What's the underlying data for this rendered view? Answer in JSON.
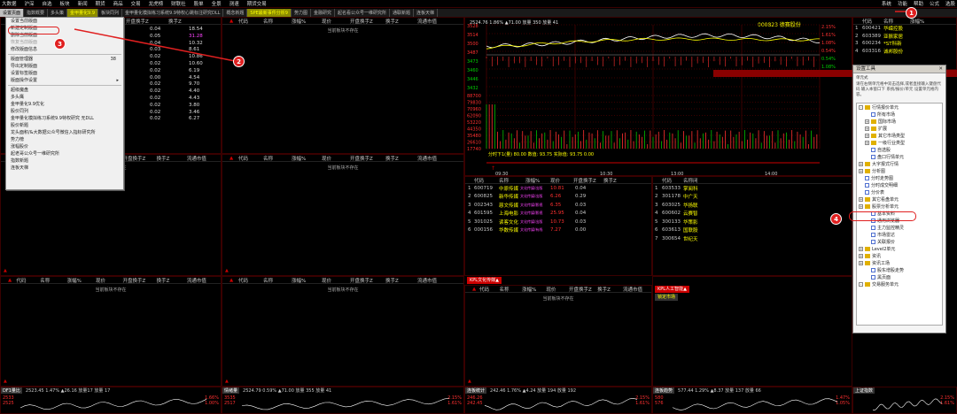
{
  "menubar": {
    "items": [
      "大数据",
      "沪深",
      "自选",
      "板块",
      "新闻",
      "期货",
      "商品",
      "交易",
      "龙虎榜",
      "财联社",
      "股单",
      "全景",
      "测速",
      "期货交易"
    ],
    "right": [
      "系统",
      "功能",
      "帮助",
      "公式",
      "选股"
    ]
  },
  "tabs": [
    "设置页面",
    "指数概要",
    "多头策",
    "金甲量化9.9",
    "板块同列",
    "金甲量化模拟练习系统9.9特权心跳标注研究DLL",
    "概念新题",
    "SPE最新事件分析9",
    "势力图",
    "金融研究",
    "起名看公众号一维研究所",
    "通联新题",
    "连板天梯"
  ],
  "context_menu": {
    "items": [
      {
        "label": "设置当前版面",
        "state": "normal"
      },
      {
        "label": "新建定制版面",
        "state": "normal"
      },
      {
        "label": "删除当前版面",
        "state": "normal"
      },
      {
        "label": "恢复当前版面",
        "state": "dim"
      },
      {
        "label": "修改版面信息",
        "state": "normal"
      },
      {
        "label": "sep",
        "state": "sep"
      },
      {
        "label": "版面管理器",
        "state": "normal",
        "shortcut": "38"
      },
      {
        "label": "导出定制版面",
        "state": "normal"
      },
      {
        "label": "设置标签版面",
        "state": "normal"
      },
      {
        "label": "版面操作设置",
        "state": "normal",
        "arrow": true
      },
      {
        "label": "sep",
        "state": "sep"
      },
      {
        "label": "超级魔盘",
        "state": "normal"
      },
      {
        "label": "多头鹰",
        "state": "normal"
      },
      {
        "label": "金甲量化9.9优化",
        "state": "normal"
      },
      {
        "label": "股价同列",
        "state": "normal"
      },
      {
        "label": "金甲量化模拟练习系统9.9特权研究 无DLL",
        "state": "normal"
      },
      {
        "label": "股价新题",
        "state": "normal"
      },
      {
        "label": "龙头面积/&大数据公众号微信入指标研究所",
        "state": "normal"
      },
      {
        "label": "势力榜",
        "state": "normal"
      },
      {
        "label": "涨幅股价",
        "state": "normal"
      },
      {
        "label": "起老哥公众号一维研究所",
        "state": "normal"
      },
      {
        "label": "指数新题",
        "state": "normal"
      },
      {
        "label": "连板天梯",
        "state": "normal"
      }
    ]
  },
  "left_numbers": {
    "col_a": [
      "0.04",
      "0.05",
      "0.04",
      "0.03",
      "0.02",
      "0.02",
      "0.02",
      "0.00",
      "0.02",
      "0.02",
      "0.02",
      "0.02",
      "0.02",
      "0.02"
    ],
    "col_b": [
      "18.54",
      "31.28",
      "10.32",
      "8.61",
      "10.86",
      "10.60",
      "6.19",
      "4.54",
      "9.70",
      "4.40",
      "4.43",
      "3.80",
      "3.46",
      "6.27"
    ],
    "head": [
      "开盘换手Z",
      "换手Z"
    ]
  },
  "panel_headers": {
    "common": [
      "代码",
      "名称",
      "涨幅%",
      "现价",
      "开盘换手Z",
      "换手Z",
      "流通市值"
    ],
    "empty_text": "当前板块不存在"
  },
  "intraday": {
    "code_title": "000823 德赛股份",
    "top_label": "2524.76  1.86%  ▲71.00  放量 350  放量 41",
    "price_left": [
      "3528",
      "3514",
      "3500",
      "3487",
      "3473",
      "3460",
      "3446",
      "3432"
    ],
    "pct_right": [
      "2.15%",
      "1.61%",
      "1.08%",
      "0.54%",
      "0.54%",
      "1.08%",
      "1.61%"
    ],
    "volume_left": [
      "88700",
      "79830",
      "70960",
      "62090",
      "53220",
      "44350",
      "35480",
      "26610",
      "17740"
    ],
    "indicator_line": "分时下1(量) 80.00  数值: 93.75  实际值: 93.75  0.00",
    "times": [
      "09:30",
      "10:30",
      "13:00",
      "14:00"
    ]
  },
  "stock_table": {
    "header": [
      "代码",
      "名称",
      "涨幅%",
      "现价",
      "开盘换手Z",
      "换手Z"
    ],
    "rows": [
      {
        "idx": "1",
        "code": "600719",
        "name": "中原传媒",
        "pct": "",
        "price": "10.81",
        "t1": "0.04",
        "tag": "文化传媒/出版"
      },
      {
        "idx": "2",
        "code": "600825",
        "name": "新华传媒",
        "pct": "",
        "price": "6.26",
        "t1": "0.29",
        "tag": "文化传媒/出版"
      },
      {
        "idx": "3",
        "code": "002343",
        "name": "慈文传媒",
        "pct": "",
        "price": "6.35",
        "t1": "0.03",
        "tag": "文化传媒/影视"
      },
      {
        "idx": "4",
        "code": "601595",
        "name": "上海电影",
        "pct": "",
        "price": "25.95",
        "t1": "0.04",
        "tag": "文化传媒/影视"
      },
      {
        "idx": "5",
        "code": "301025",
        "name": "读客文化",
        "pct": "",
        "price": "10.73",
        "t1": "0.03",
        "tag": "文化传媒/出版"
      },
      {
        "idx": "6",
        "code": "000156",
        "name": "华数传媒",
        "pct": "",
        "price": "7.27",
        "t1": "0.00",
        "tag": "文化传媒/有线"
      }
    ]
  },
  "right_top": {
    "header": [
      "代码",
      "名称",
      "涨幅%"
    ],
    "rows": [
      {
        "idx": "1",
        "code": "600421",
        "name": "华嵘控股"
      },
      {
        "idx": "2",
        "code": "603389",
        "name": "亚振家居"
      },
      {
        "idx": "3",
        "code": "600234",
        "name": "*ST科新"
      },
      {
        "idx": "4",
        "code": "603316",
        "name": "诚邦股份"
      }
    ]
  },
  "right_mid": {
    "header": [
      "代码",
      "名称闭"
    ],
    "rows": [
      {
        "idx": "1",
        "code": "603533",
        "name": "掌阅科"
      },
      {
        "idx": "2",
        "code": "301178",
        "name": "中广天"
      },
      {
        "idx": "3",
        "code": "603025",
        "name": "华扬联"
      },
      {
        "idx": "4",
        "code": "600602",
        "name": "云赛智"
      },
      {
        "idx": "5",
        "code": "300133",
        "name": "华策影"
      },
      {
        "idx": "6",
        "code": "603613",
        "name": "国联股"
      },
      {
        "idx": "7",
        "code": "300654",
        "name": "世纪天"
      }
    ]
  },
  "dialog": {
    "title": "设置工具",
    "subtitle": "单元式",
    "desc": "请在右侧单元格中双击选择,或者直接输入键盘代码 输入本窗口下 系统/报价/单元 设置单元格内容。",
    "tree": [
      {
        "label": "行情报价单元",
        "type": "folder",
        "depth": 0,
        "exp": "-"
      },
      {
        "label": "所有市场",
        "type": "page",
        "depth": 1
      },
      {
        "label": "国际市场",
        "type": "folder",
        "depth": 1,
        "exp": "+"
      },
      {
        "label": "扩展",
        "type": "folder",
        "depth": 1,
        "exp": "+"
      },
      {
        "label": "其它市场类型",
        "type": "folder",
        "depth": 1,
        "exp": "+"
      },
      {
        "label": "一级行业类型",
        "type": "folder",
        "depth": 1,
        "exp": "+"
      },
      {
        "label": "自选股",
        "type": "page",
        "depth": 1
      },
      {
        "label": "盘口行情单元",
        "type": "page",
        "depth": 1
      },
      {
        "label": "大字报式行情",
        "type": "folder",
        "depth": 0,
        "exp": "+"
      },
      {
        "label": "分析图",
        "type": "folder",
        "depth": 0,
        "exp": "+"
      },
      {
        "label": "分时走势图",
        "type": "page",
        "depth": 0
      },
      {
        "label": "分时成交明细",
        "type": "page",
        "depth": 0
      },
      {
        "label": "分价表",
        "type": "page",
        "depth": 0
      },
      {
        "label": "其它看盘单元",
        "type": "folder",
        "depth": 0,
        "exp": "+"
      },
      {
        "label": "股票分析单元",
        "type": "folder",
        "depth": 0,
        "exp": "+"
      },
      {
        "label": "基本资料",
        "type": "page",
        "depth": 1
      },
      {
        "label": "通用浏览器",
        "type": "page",
        "depth": 1
      },
      {
        "label": "主力监控精灵",
        "type": "page",
        "depth": 1
      },
      {
        "label": "市场雷达",
        "type": "page",
        "depth": 1
      },
      {
        "label": "关联报价",
        "type": "page",
        "depth": 1
      },
      {
        "label": "Level2单元",
        "type": "folder",
        "depth": 0,
        "exp": "+"
      },
      {
        "label": "资讯",
        "type": "folder",
        "depth": 0,
        "exp": "+"
      },
      {
        "label": "资讯工场",
        "type": "folder",
        "depth": 0,
        "exp": "+"
      },
      {
        "label": "股东增股走势",
        "type": "page",
        "depth": 1
      },
      {
        "label": "黑页面",
        "type": "page",
        "depth": 1
      },
      {
        "label": "交易服务单元",
        "type": "folder",
        "depth": 0,
        "exp": "-"
      }
    ]
  },
  "tags": {
    "kpl_culture": "KPL文化传媒▲",
    "kpl_ai": "KPL人工智能▲",
    "lock_market": "锁定市场"
  },
  "bottom_panels": [
    {
      "title": "DF1量比",
      "values": "2523.45  1.47%  ▲26.16  放量17 放量 17",
      "pcts": [
        "1.66%",
        "1.00%"
      ],
      "axis": [
        "2533",
        "2525"
      ]
    },
    {
      "title": "情绪量",
      "values": "2524.79  0.59%  ▲71.00  放量 355  放量 41",
      "pcts": [
        "2.15%",
        "1.61%"
      ],
      "axis": [
        "3535",
        "2517"
      ]
    },
    {
      "title": "连板统计",
      "values": "242.46  1.76%  ▲4.24  放量 194  放量 192",
      "pcts": [
        "2.15%",
        "1.61%"
      ],
      "axis": [
        "246.26",
        "242.45"
      ]
    },
    {
      "title": "连板趋势",
      "values": "577.44  1.29%  ▲8.37  放量 137  放量 66",
      "pcts": [
        "1.47%",
        "1.05%"
      ],
      "axis": [
        "580",
        "576"
      ]
    },
    {
      "title": "上证指数",
      "values": "",
      "pcts": [
        "2.15%",
        "1.61%"
      ],
      "axis": [
        "",
        "",
        ""
      ]
    }
  ],
  "annotations": [
    "1",
    "2",
    "3",
    "4"
  ],
  "colors": {
    "accent": "#e02020",
    "border": "#3a0000",
    "up": "#ff3030",
    "down": "#00d000"
  }
}
